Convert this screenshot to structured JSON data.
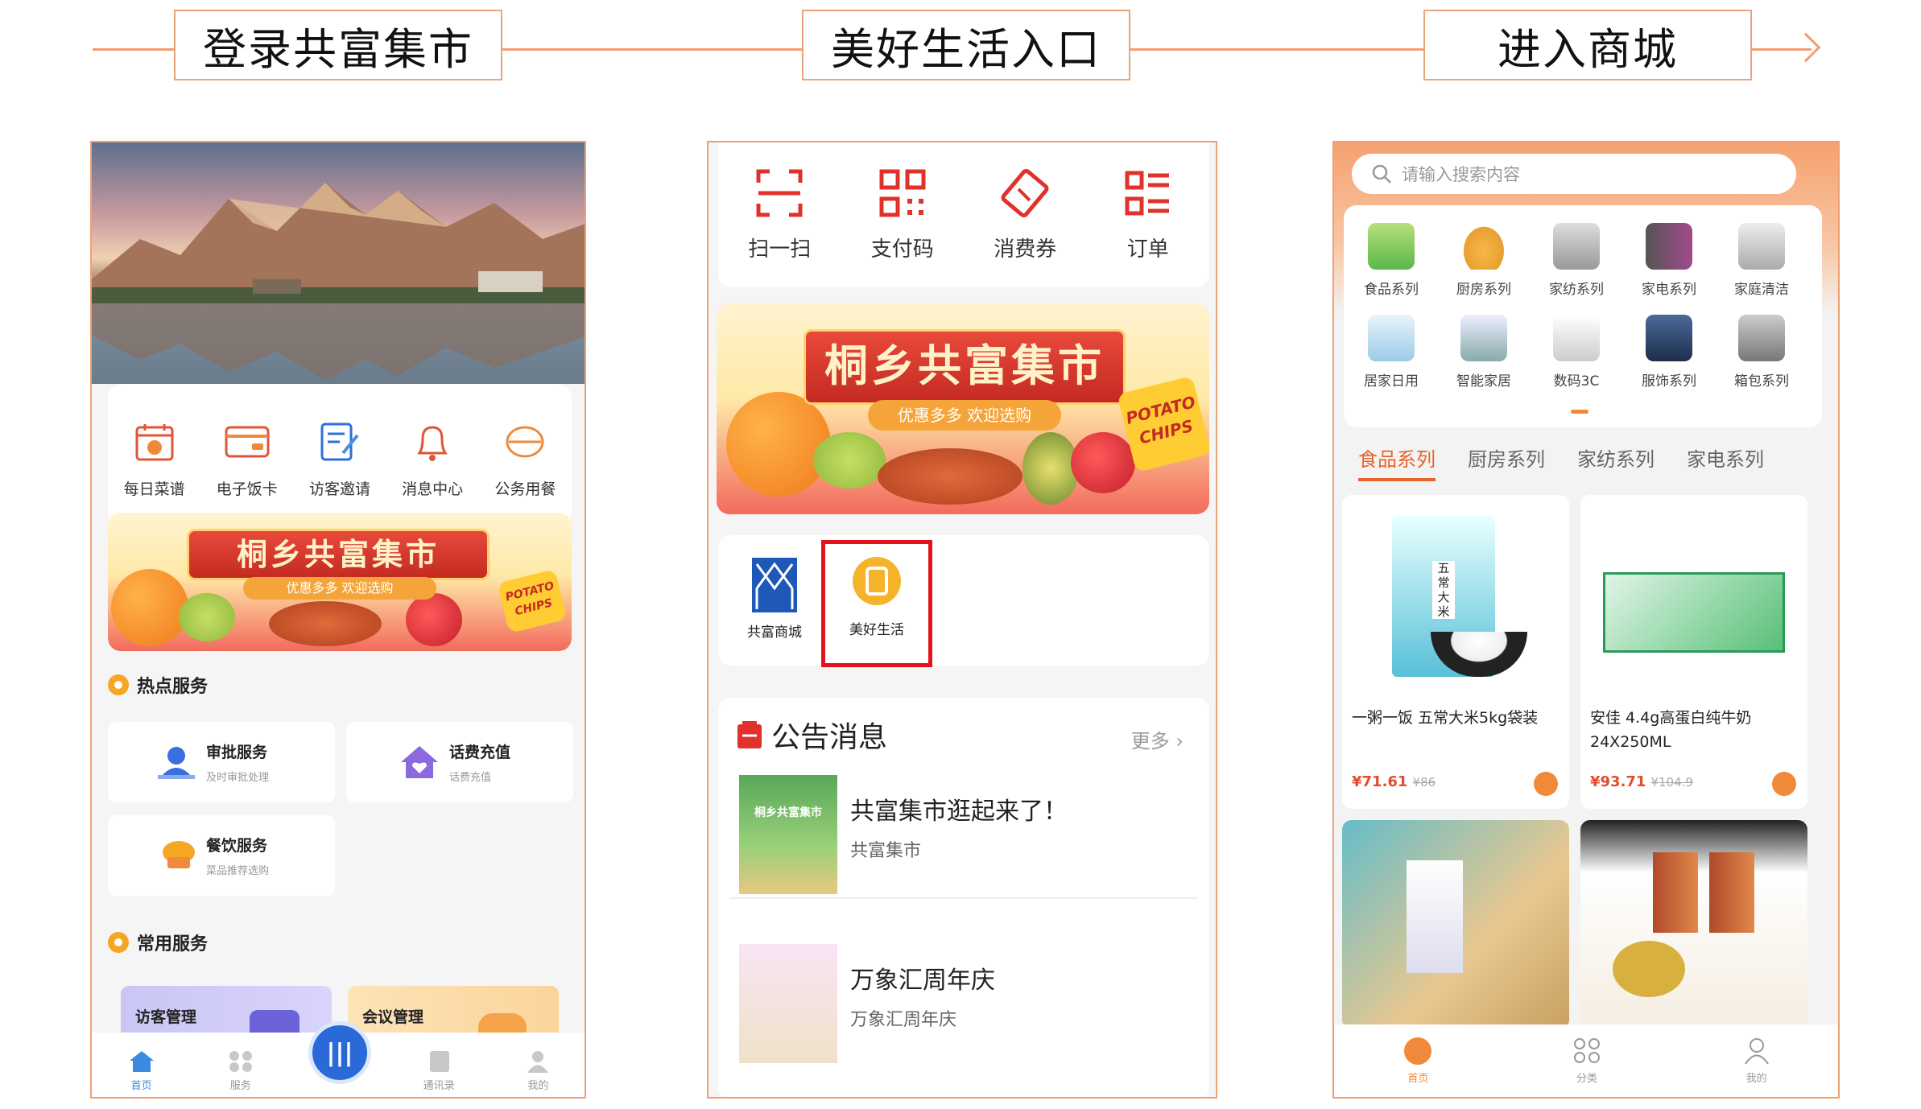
{
  "flow": {
    "step1": "登录共富集市",
    "step2": "美好生活入口",
    "step3": "进入商城"
  },
  "colors": {
    "accent": "#f0a070",
    "orange": "#f08a3a",
    "red": "#e0322a",
    "price": "#e34c2c"
  },
  "panel1": {
    "quick_items": [
      {
        "label": "每日菜谱",
        "icon": "recipe-icon"
      },
      {
        "label": "电子饭卡",
        "icon": "meal-card-icon"
      },
      {
        "label": "访客邀请",
        "icon": "invite-icon"
      },
      {
        "label": "消息中心",
        "icon": "bell-icon"
      },
      {
        "label": "公务用餐",
        "icon": "dining-icon"
      }
    ],
    "banner": {
      "title": "桐乡共富集市",
      "sub": "优惠多多 欢迎选购",
      "chips": "POTATO CHIPS"
    },
    "hot_title": "热点服务",
    "hot_cards": [
      {
        "title": "审批服务",
        "sub": "及时审批处理"
      },
      {
        "title": "话费充值",
        "sub": "话费充值"
      },
      {
        "title": "餐饮服务",
        "sub": "菜品推荐选购"
      }
    ],
    "common_title": "常用服务",
    "common_cards": [
      {
        "title": "访客管理"
      },
      {
        "title": "会议管理"
      }
    ],
    "tabbar": [
      {
        "label": "首页"
      },
      {
        "label": "服务"
      },
      {
        "label": ""
      },
      {
        "label": "通讯录"
      },
      {
        "label": "我的"
      }
    ]
  },
  "panel2": {
    "top_items": [
      {
        "label": "扫一扫",
        "icon": "scan-icon"
      },
      {
        "label": "支付码",
        "icon": "qr-code-icon"
      },
      {
        "label": "消费券",
        "icon": "coupon-icon"
      },
      {
        "label": "订单",
        "icon": "order-list-icon"
      }
    ],
    "banner": {
      "title": "桐乡共富集市",
      "sub": "优惠多多 欢迎选购",
      "chips": "POTATO CHIPS"
    },
    "apps": [
      {
        "label": "共富商城"
      },
      {
        "label": "美好生活"
      }
    ],
    "notice_title": "公告消息",
    "more": "更多",
    "notices": [
      {
        "title": "共富集市逛起来了！",
        "sub": "共富集市",
        "thumb": "桐乡共富集市"
      },
      {
        "title": "万象汇周年庆",
        "sub": "万象汇周年庆"
      }
    ]
  },
  "panel3": {
    "search_placeholder": "请输入搜索内容",
    "categories": [
      "食品系列",
      "厨房系列",
      "家纺系列",
      "家电系列",
      "家庭清洁",
      "居家日用",
      "智能家居",
      "数码3C",
      "服饰系列",
      "箱包系列"
    ],
    "tabs": [
      "食品系列",
      "厨房系列",
      "家纺系列",
      "家电系列"
    ],
    "products": [
      {
        "name": "一粥一饭 五常大米5kg袋装",
        "price": "¥71.61",
        "old": "¥86",
        "pack": "五常大米"
      },
      {
        "name": "安佳 4.4g高蛋白纯牛奶24X250ML",
        "price": "¥93.71",
        "old": "¥104.9"
      }
    ],
    "tabbar": [
      {
        "label": "首页"
      },
      {
        "label": "分类"
      },
      {
        "label": "我的"
      }
    ]
  }
}
